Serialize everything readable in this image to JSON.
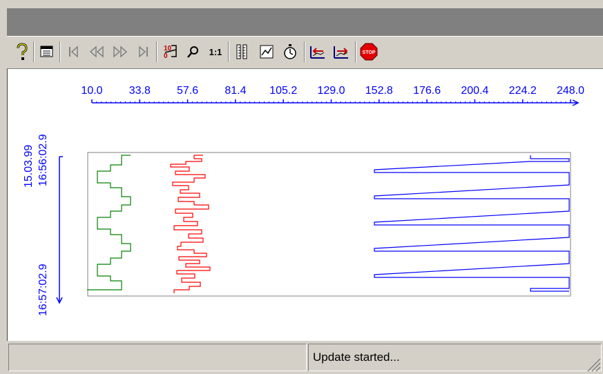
{
  "toolbar": {
    "buttons": [
      {
        "name": "help-button",
        "icon": "help-question-icon"
      },
      {
        "name": "table-view-button",
        "icon": "table-icon"
      },
      {
        "name": "first-record-button",
        "icon": "first-icon"
      },
      {
        "name": "rewind-button",
        "icon": "rewind-icon"
      },
      {
        "name": "fast-forward-button",
        "icon": "fast-forward-icon"
      },
      {
        "name": "last-record-button",
        "icon": "last-icon"
      },
      {
        "name": "scale-button",
        "icon": "scale-icon"
      },
      {
        "name": "zoom-button",
        "icon": "zoom-icon"
      },
      {
        "name": "original-size-button",
        "icon": "one-to-one-icon",
        "label": "1:1"
      },
      {
        "name": "ruler-button",
        "icon": "ruler-icon"
      },
      {
        "name": "trend-button",
        "icon": "trend-icon"
      },
      {
        "name": "stopwatch-button",
        "icon": "stopwatch-icon"
      },
      {
        "name": "previous-curve-button",
        "icon": "previous-curve-icon"
      },
      {
        "name": "next-curve-button",
        "icon": "next-curve-icon"
      },
      {
        "name": "stop-button",
        "icon": "stop-icon",
        "label": "STOP"
      }
    ]
  },
  "trend": {
    "value_axis_ticks": [
      "10.0",
      "33.8",
      "57.6",
      "81.4",
      "105.2",
      "129.0",
      "152.8",
      "176.6",
      "200.4",
      "224.2",
      "248.0"
    ],
    "time_axis_start": "15.03.99\n16:56:02.9",
    "time_axis_start_date": "15.03.99",
    "time_axis_start_time": "16:56:02.9",
    "time_axis_end_time": "16:57:02.9",
    "colors": {
      "axis": "#0000ff",
      "green": "#008000",
      "red": "#ff0000",
      "blue": "#0000ff",
      "frame": "#808080"
    }
  },
  "status": {
    "message": "Update started..."
  },
  "chart_data": {
    "type": "line",
    "xlabel": "",
    "ylabel": "",
    "xlim": [
      10.0,
      248.0
    ],
    "x_ticks": [
      "10.0",
      "33.8",
      "57.6",
      "81.4",
      "105.2",
      "129.0",
      "152.8",
      "176.6",
      "200.4",
      "224.2",
      "248.0"
    ],
    "y_range": [
      "16:56:02.9",
      "16:57:02.9"
    ],
    "series": []
  }
}
